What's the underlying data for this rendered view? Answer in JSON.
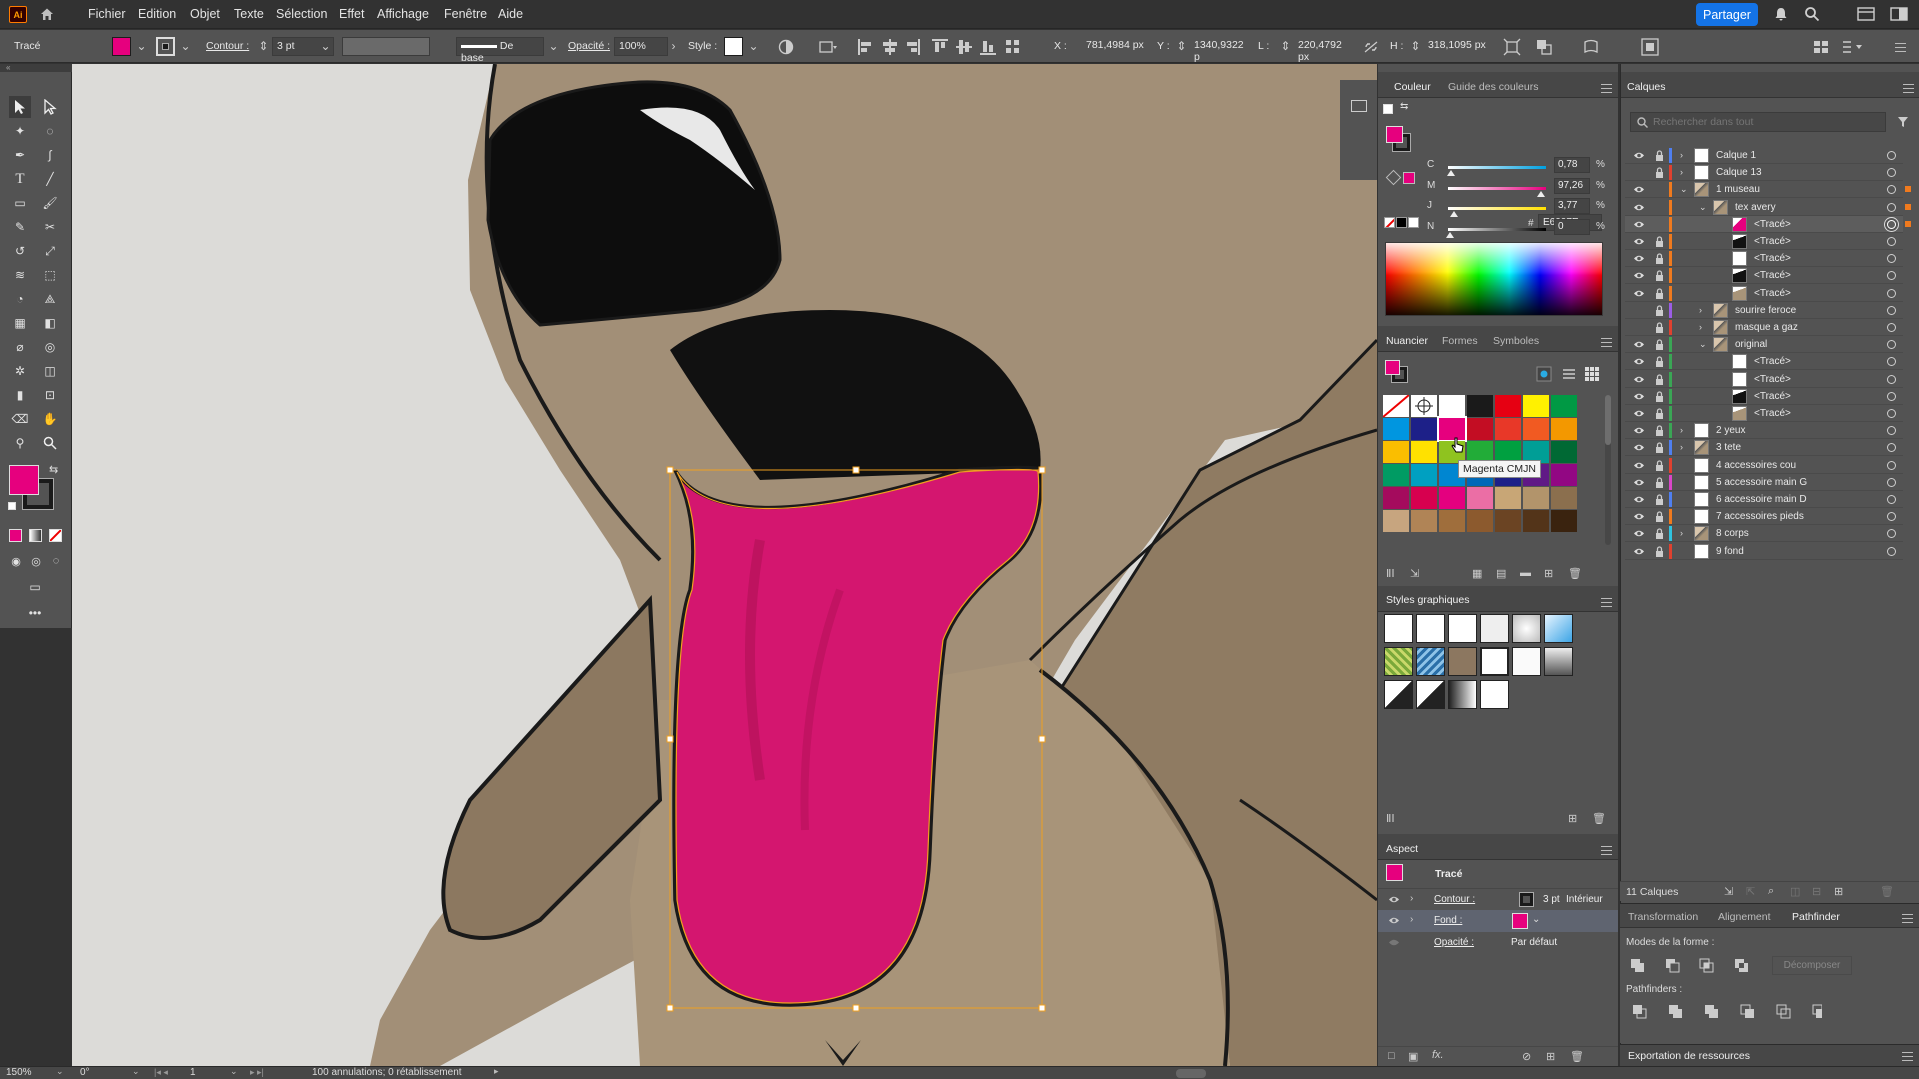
{
  "menubar": {
    "logo": "Ai",
    "items": [
      "Fichier",
      "Edition",
      "Objet",
      "Texte",
      "Sélection",
      "Effet",
      "Affichage",
      "Fenêtre",
      "Aide"
    ],
    "share": "Partager"
  },
  "control": {
    "object_type": "Tracé",
    "contour_label": "Contour :",
    "contour_value": "3 pt",
    "stroke_profile": "De base",
    "opacity_label": "Opacité :",
    "opacity_value": "100%",
    "style_label": "Style :",
    "x_label": "X :",
    "x_value": "781,4984 px",
    "y_label": "Y :",
    "y_value": "1340,9322 p",
    "w_label": "L :",
    "w_value": "220,4792 px",
    "h_label": "H :",
    "h_value": "318,1095 px",
    "fill_color": "#e6007e",
    "stroke_color": "#1a1a1a"
  },
  "color_panel": {
    "tab1": "Couleur",
    "tab2": "Guide des couleurs",
    "channels": [
      {
        "name": "C",
        "value": "0,78",
        "pct": 0.0078,
        "color": "#00a0e0"
      },
      {
        "name": "M",
        "value": "97,26",
        "pct": 0.9726,
        "color": "#e6007e"
      },
      {
        "name": "J",
        "value": "3,77",
        "pct": 0.0377,
        "color": "#ffe000"
      },
      {
        "name": "N",
        "value": "0",
        "pct": 0,
        "color": "#000000"
      }
    ],
    "pct_sign": "%",
    "hex_label": "#",
    "hex": "E6007E"
  },
  "swatches_panel": {
    "tab1": "Nuancier",
    "tab2": "Formes",
    "tab3": "Symboles",
    "tooltip": "Magenta CMJN",
    "colors": [
      [
        "none",
        "reg",
        "#ffffff",
        "#1a1a1a",
        "#e60012",
        "#fff100",
        "#009944"
      ],
      [
        "#0096e0",
        "#1d2088",
        "#e6007e",
        "#c30d23",
        "#e83828",
        "#f15a22",
        "#f39800"
      ],
      [
        "#fabe00",
        "#ffe100",
        "#8fc31f",
        "#22ac38",
        "#00a040",
        "#009e96",
        "#006934"
      ],
      [
        "#009b63",
        "#00a0c1",
        "#0086d1",
        "#0068b7",
        "#1d2088",
        "#601986",
        "#920783"
      ],
      [
        "#a40b5d",
        "#d7004f",
        "#e4007f",
        "#eb6ea5",
        "#c8a676",
        "#b2946b",
        "#8b6f4e"
      ],
      [
        "#c7a57f",
        "#b08456",
        "#9f6e3c",
        "#8c5a2e",
        "#6b4423",
        "#533419",
        "#3a230f"
      ]
    ]
  },
  "graphic_styles": {
    "title": "Styles graphiques"
  },
  "aspect": {
    "title": "Aspect",
    "object": "Tracé",
    "contour_label": "Contour :",
    "contour_value": "3 pt",
    "contour_align": "Intérieur",
    "fill_label": "Fond :",
    "opacity_label": "Opacité :",
    "opacity_value": "Par défaut",
    "fill_color": "#e6007e"
  },
  "layers": {
    "title": "Calques",
    "search_placeholder": "Rechercher dans tout",
    "count": "11 Calques",
    "rows": [
      {
        "name": "Calque 1",
        "indent": 0,
        "expand": "›",
        "eye": true,
        "lock": true,
        "color": "#4f7ff0",
        "thumb": "white",
        "target_fill": false
      },
      {
        "name": "Calque 13",
        "indent": 0,
        "expand": "›",
        "eye": false,
        "lock": true,
        "color": "#e0412f",
        "thumb": "white",
        "target_fill": false
      },
      {
        "name": "1 museau",
        "indent": 0,
        "expand": "⌄",
        "eye": true,
        "lock": false,
        "color": "#f07a1e",
        "thumb": "art",
        "target_fill": true
      },
      {
        "name": "tex avery",
        "indent": 1,
        "expand": "⌄",
        "eye": true,
        "lock": false,
        "color": "#f07a1e",
        "thumb": "art",
        "target_fill": true
      },
      {
        "name": "<Tracé>",
        "indent": 2,
        "expand": "",
        "eye": true,
        "lock": false,
        "color": "#f07a1e",
        "thumb": "pink",
        "target_fill": true,
        "selected": true
      },
      {
        "name": "<Tracé>",
        "indent": 2,
        "expand": "",
        "eye": true,
        "lock": true,
        "color": "#f07a1e",
        "thumb": "black",
        "target_fill": false
      },
      {
        "name": "<Tracé>",
        "indent": 2,
        "expand": "",
        "eye": true,
        "lock": true,
        "color": "#f07a1e",
        "thumb": "white",
        "target_fill": false
      },
      {
        "name": "<Tracé>",
        "indent": 2,
        "expand": "",
        "eye": true,
        "lock": true,
        "color": "#f07a1e",
        "thumb": "black",
        "target_fill": false
      },
      {
        "name": "<Tracé>",
        "indent": 2,
        "expand": "",
        "eye": true,
        "lock": true,
        "color": "#f07a1e",
        "thumb": "brown",
        "target_fill": false
      },
      {
        "name": "sourire feroce",
        "indent": 1,
        "expand": "›",
        "eye": false,
        "lock": true,
        "color": "#9b5de5",
        "thumb": "art",
        "target_fill": false
      },
      {
        "name": "masque a gaz",
        "indent": 1,
        "expand": "›",
        "eye": false,
        "lock": true,
        "color": "#e0412f",
        "thumb": "art",
        "target_fill": false
      },
      {
        "name": "original",
        "indent": 1,
        "expand": "⌄",
        "eye": true,
        "lock": true,
        "color": "#3aa655",
        "thumb": "art",
        "target_fill": false
      },
      {
        "name": "<Tracé>",
        "indent": 2,
        "expand": "",
        "eye": true,
        "lock": true,
        "color": "#3aa655",
        "thumb": "white",
        "target_fill": false
      },
      {
        "name": "<Tracé>",
        "indent": 2,
        "expand": "",
        "eye": true,
        "lock": true,
        "color": "#3aa655",
        "thumb": "white",
        "target_fill": false
      },
      {
        "name": "<Tracé>",
        "indent": 2,
        "expand": "",
        "eye": true,
        "lock": true,
        "color": "#3aa655",
        "thumb": "black",
        "target_fill": false
      },
      {
        "name": "<Tracé>",
        "indent": 2,
        "expand": "",
        "eye": true,
        "lock": true,
        "color": "#3aa655",
        "thumb": "brown",
        "target_fill": false
      },
      {
        "name": "2 yeux",
        "indent": 0,
        "expand": "›",
        "eye": true,
        "lock": true,
        "color": "#3aa655",
        "thumb": "white",
        "target_fill": false
      },
      {
        "name": "3 tete",
        "indent": 0,
        "expand": "›",
        "eye": true,
        "lock": true,
        "color": "#4f7ff0",
        "thumb": "art",
        "target_fill": false
      },
      {
        "name": "4 accessoires cou",
        "indent": 0,
        "expand": "",
        "eye": true,
        "lock": true,
        "color": "#e0412f",
        "thumb": "white",
        "target_fill": false
      },
      {
        "name": "5 accessoire main G",
        "indent": 0,
        "expand": "",
        "eye": true,
        "lock": true,
        "color": "#d946c8",
        "thumb": "white",
        "target_fill": false
      },
      {
        "name": "6 accessoire main D",
        "indent": 0,
        "expand": "",
        "eye": true,
        "lock": true,
        "color": "#4f7ff0",
        "thumb": "white",
        "target_fill": false
      },
      {
        "name": "7 accessoires pieds",
        "indent": 0,
        "expand": "",
        "eye": true,
        "lock": true,
        "color": "#f07a1e",
        "thumb": "white",
        "target_fill": false
      },
      {
        "name": "8 corps",
        "indent": 0,
        "expand": "›",
        "eye": true,
        "lock": true,
        "color": "#2fc3e0",
        "thumb": "art",
        "target_fill": false
      },
      {
        "name": "9 fond",
        "indent": 0,
        "expand": "",
        "eye": true,
        "lock": true,
        "color": "#e0412f",
        "thumb": "white",
        "target_fill": false
      }
    ]
  },
  "pathfinder": {
    "tab1": "Transformation",
    "tab2": "Alignement",
    "tab3": "Pathfinder",
    "modes_label": "Modes de la forme :",
    "decompose": "Décomposer",
    "pathfinders_label": "Pathfinders :"
  },
  "export": {
    "title": "Exportation de ressources"
  },
  "status": {
    "zoom": "150%",
    "rotation": "0°",
    "artboard": "1",
    "history": "100 annulations; 0 rétablissement"
  }
}
